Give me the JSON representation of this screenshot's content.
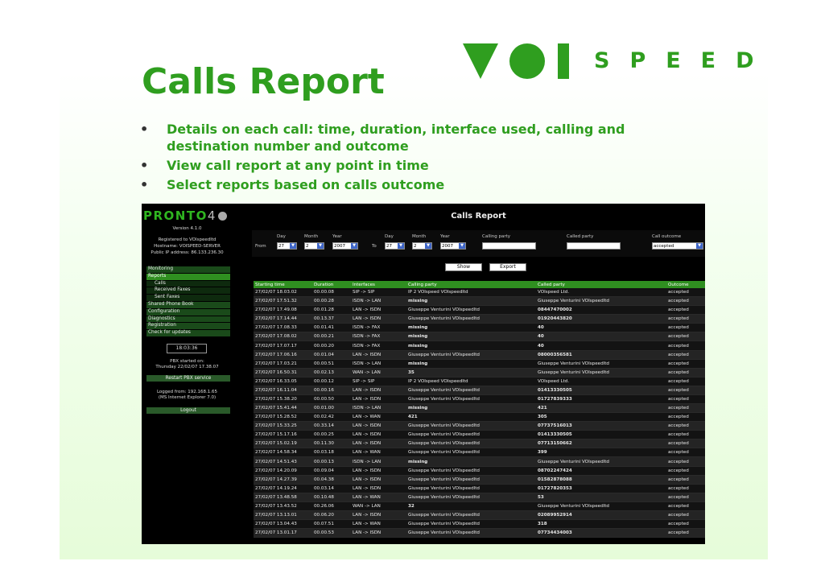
{
  "slide": {
    "title": "Calls Report",
    "logo": {
      "mark": "VOI",
      "text": "SPEED",
      "color": "#2f9e1f"
    },
    "bullets": [
      "Details on each call: time, duration, interface used, calling and destination number and outcome",
      "View call report at any point in time",
      "Select reports based on calls outcome"
    ]
  },
  "app": {
    "brand": "PRONTO",
    "brand_suffix": "4",
    "version": "Version 4.1.0",
    "registered": "Registered to VOIspeedltd",
    "hostname": "Hostname: VOISPEED-SERVER",
    "public_ip": "Public IP address: 86.133.236.30",
    "nav": [
      {
        "label": "Monitoring",
        "type": "top"
      },
      {
        "label": "Reports",
        "type": "active"
      },
      {
        "label": "Calls",
        "type": "sub"
      },
      {
        "label": "Received Faxes",
        "type": "sub"
      },
      {
        "label": "Sent Faxes",
        "type": "sub"
      },
      {
        "label": "Shared Phone Book",
        "type": "top"
      },
      {
        "label": "Configuration",
        "type": "top"
      },
      {
        "label": "Diagnostics",
        "type": "top"
      },
      {
        "label": "Registration",
        "type": "top"
      },
      {
        "label": "Check for updates",
        "type": "top"
      }
    ],
    "clock": "18:03:36",
    "pbx_started": "PBX started on:",
    "pbx_started_date": "Thursday 22/02/07 17.38.07",
    "restart_label": "Restart PBX service",
    "logged_from": "Logged from: 192.168.1.65",
    "browser": "(MS Internet Explorer 7.0)",
    "logout_label": "Logout"
  },
  "report": {
    "heading": "Calls Report",
    "filters": {
      "from_label": "From",
      "to_label": "To",
      "day_label": "Day",
      "month_label": "Month",
      "year_label": "Year",
      "from_day": "27",
      "from_month": "2",
      "from_year": "2007",
      "to_day": "27",
      "to_month": "2",
      "to_year": "2007",
      "calling_party_label": "Calling party",
      "called_party_label": "Called party",
      "call_outcome_label": "Call outcome",
      "call_outcome_value": "accepted"
    },
    "show_label": "Show",
    "export_label": "Export",
    "columns": [
      "Starting time",
      "Duration",
      "Interfaces",
      "Calling party",
      "Called party",
      "Outcome"
    ],
    "rows": [
      [
        "27/02/07 18.03.02",
        "00.00.08",
        "SIP -> SIP",
        "IP 2 VOIspeed VOIspeedltd",
        "VOIspeed Ltd.",
        "accepted"
      ],
      [
        "27/02/07 17.51.32",
        "00.00.28",
        "ISDN -> LAN",
        "missing",
        "Giuseppe Venturini VOIspeedltd",
        "accepted"
      ],
      [
        "27/02/07 17.49.08",
        "00.01.28",
        "LAN -> ISDN",
        "Giuseppe Venturini VOIspeedltd",
        "08447470002",
        "accepted"
      ],
      [
        "27/02/07 17.14.44",
        "00.13.37",
        "LAN -> ISDN",
        "Giuseppe Venturini VOIspeedltd",
        "01920443820",
        "accepted"
      ],
      [
        "27/02/07 17.08.33",
        "00.01.41",
        "ISDN -> FAX",
        "missing",
        "40",
        "accepted"
      ],
      [
        "27/02/07 17.08.02",
        "00.00.21",
        "ISDN -> FAX",
        "missing",
        "40",
        "accepted"
      ],
      [
        "27/02/07 17.07.17",
        "00.00.20",
        "ISDN -> FAX",
        "missing",
        "40",
        "accepted"
      ],
      [
        "27/02/07 17.06.16",
        "00.01.04",
        "LAN -> ISDN",
        "Giuseppe Venturini VOIspeedltd",
        "08000356581",
        "accepted"
      ],
      [
        "27/02/07 17.03.21",
        "00.00.51",
        "ISDN -> LAN",
        "missing",
        "Giuseppe Venturini VOIspeedltd",
        "accepted"
      ],
      [
        "27/02/07 16.50.31",
        "00.02.13",
        "WAN -> LAN",
        "35",
        "Giuseppe Venturini VOIspeedltd",
        "accepted"
      ],
      [
        "27/02/07 16.33.05",
        "00.00.12",
        "SIP -> SIP",
        "IP 2 VOIspeed VOIspeedltd",
        "VOIspeed Ltd.",
        "accepted"
      ],
      [
        "27/02/07 16.11.04",
        "00.00.16",
        "LAN -> ISDN",
        "Giuseppe Venturini VOIspeedltd",
        "01413330505",
        "accepted"
      ],
      [
        "27/02/07 15.38.20",
        "00.00.50",
        "LAN -> ISDN",
        "Giuseppe Venturini VOIspeedltd",
        "01727839333",
        "accepted"
      ],
      [
        "27/02/07 15.41.44",
        "00.01.00",
        "ISDN -> LAN",
        "missing",
        "421",
        "accepted"
      ],
      [
        "27/02/07 15.28.52",
        "00.02.42",
        "LAN -> WAN",
        "421",
        "305",
        "accepted"
      ],
      [
        "27/02/07 15.33.25",
        "00.33.14",
        "LAN -> ISDN",
        "Giuseppe Venturini VOIspeedltd",
        "07737516013",
        "accepted"
      ],
      [
        "27/02/07 15.17.16",
        "00.00.25",
        "LAN -> ISDN",
        "Giuseppe Venturini VOIspeedltd",
        "01413330505",
        "accepted"
      ],
      [
        "27/02/07 15.02.19",
        "00.11.30",
        "LAN -> ISDN",
        "Giuseppe Venturini VOIspeedltd",
        "07713150662",
        "accepted"
      ],
      [
        "27/02/07 14.58.34",
        "00.03.18",
        "LAN -> WAN",
        "Giuseppe Venturini VOIspeedltd",
        "399",
        "accepted"
      ],
      [
        "27/02/07 14.51.43",
        "00.00.13",
        "ISDN -> LAN",
        "missing",
        "Giuseppe Venturini VOIspeedltd",
        "accepted"
      ],
      [
        "27/02/07 14.20.09",
        "00.09.04",
        "LAN -> ISDN",
        "Giuseppe Venturini VOIspeedltd",
        "08702247424",
        "accepted"
      ],
      [
        "27/02/07 14.27.39",
        "00.04.38",
        "LAN -> ISDN",
        "Giuseppe Venturini VOIspeedltd",
        "01582878088",
        "accepted"
      ],
      [
        "27/02/07 14.19.24",
        "00.03.14",
        "LAN -> ISDN",
        "Giuseppe Venturini VOIspeedltd",
        "01727820353",
        "accepted"
      ],
      [
        "27/02/07 13.48.58",
        "00.10.48",
        "LAN -> WAN",
        "Giuseppe Venturini VOIspeedltd",
        "53",
        "accepted"
      ],
      [
        "27/02/07 13.43.52",
        "00.26.06",
        "WAN -> LAN",
        "32",
        "Giuseppe Venturini VOIspeedltd",
        "accepted"
      ],
      [
        "27/02/07 13.13.01",
        "00.06.20",
        "LAN -> ISDN",
        "Giuseppe Venturini VOIspeedltd",
        "02089952914",
        "accepted"
      ],
      [
        "27/02/07 13.04.43",
        "00.07.51",
        "LAN -> WAN",
        "Giuseppe Venturini VOIspeedltd",
        "318",
        "accepted"
      ],
      [
        "27/02/07 13.01.17",
        "00.00.53",
        "LAN -> ISDN",
        "Giuseppe Venturini VOIspeedltd",
        "07734434003",
        "accepted"
      ]
    ]
  }
}
